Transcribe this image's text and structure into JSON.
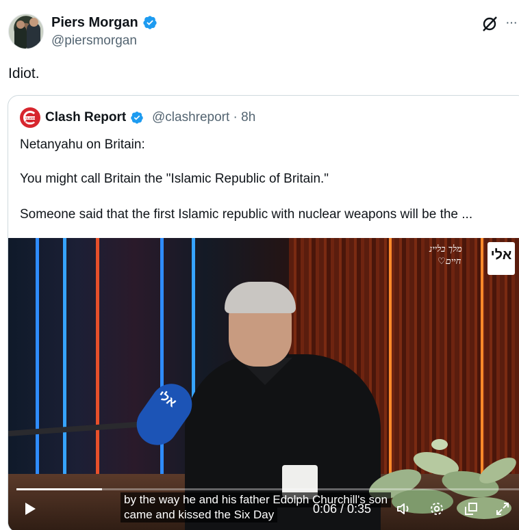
{
  "author": {
    "name": "Piers Morgan",
    "handle": "@piersmorgan",
    "verified": true
  },
  "tweet": {
    "text": "Idiot."
  },
  "header_icons": [
    "grok-icon",
    "more-icon"
  ],
  "more_label": "···",
  "quote": {
    "name": "Clash Report",
    "handle_time": "@clashreport · 8h",
    "avatar_text": "CLASH REPORT",
    "lines": [
      "Netanyahu on Britain:",
      "You might call Britain the \"Islamic Republic of Britain.\"",
      "Someone said that the first Islamic republic with nuclear weapons will be the ..."
    ]
  },
  "video": {
    "caption_lines": [
      "by the way he and his father Edolph Churchill's son",
      "came and kissed the Six Day"
    ],
    "time": "0:06 / 0:35",
    "progress": 0.17,
    "channel_logo": "אלי",
    "mic_label": "אלי",
    "signature_lines": [
      "מלך בליינ",
      "♡חיים"
    ],
    "controls": [
      "play-icon",
      "volume-icon",
      "settings-icon",
      "popout-icon",
      "fullscreen-icon"
    ]
  },
  "colors": {
    "verified_blue": "#1d9bf0",
    "brand_red": "#d7262e",
    "secondary_text": "#536471"
  }
}
